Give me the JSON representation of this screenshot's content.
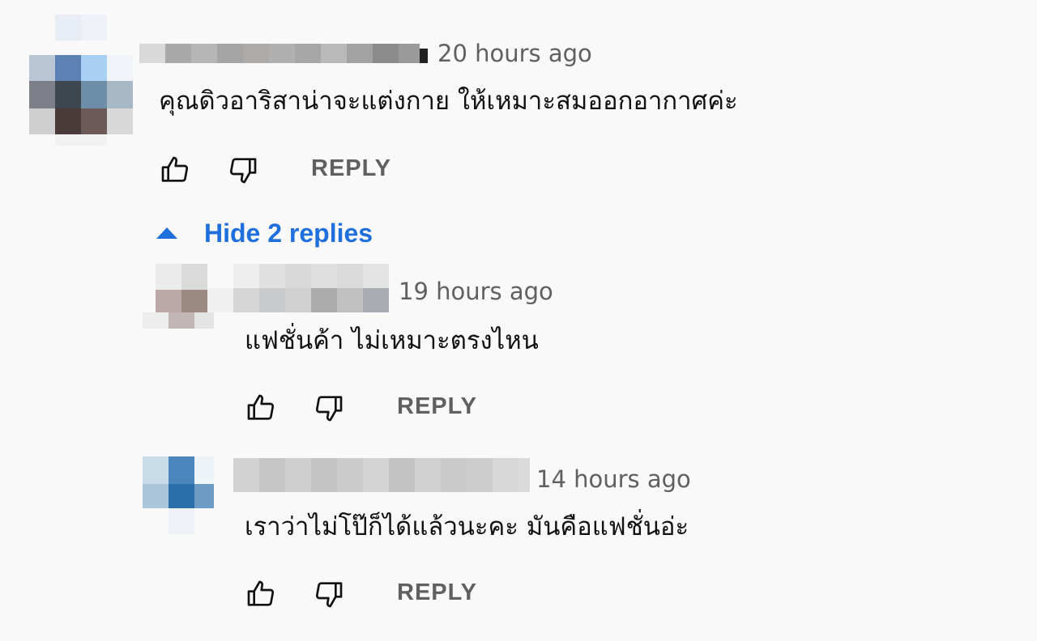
{
  "thread": {
    "toggle_replies_label": "Hide 2 replies",
    "accent_color": "#1f6fdc"
  },
  "comments": [
    {
      "time": "20 hours ago",
      "text": "คุณดิวอาริสาน่าจะแต่งกาย ให้เหมาะสมออกอากาศค่ะ",
      "reply_label": "REPLY"
    },
    {
      "time": "19 hours ago",
      "text": "แฟชั่นค้า ไม่เหมาะตรงไหน",
      "reply_label": "REPLY"
    },
    {
      "time": "14 hours ago",
      "text": "เราว่าไม่โป๊ก็ได้แล้วนะคะ มันคือแฟชั่นอ่ะ",
      "reply_label": "REPLY"
    }
  ]
}
